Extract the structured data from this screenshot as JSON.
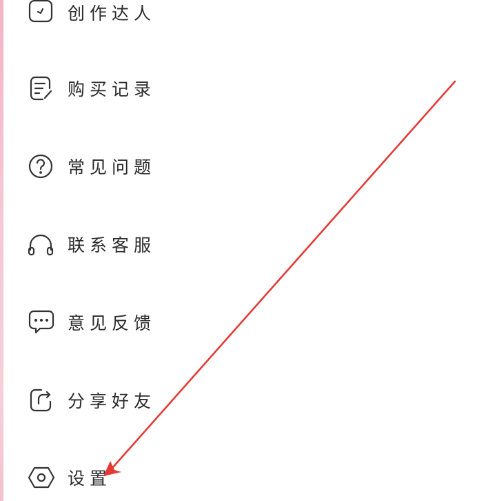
{
  "menu": {
    "items": [
      {
        "label": "创作达人",
        "icon": "creator-icon"
      },
      {
        "label": "购买记录",
        "icon": "purchase-record-icon"
      },
      {
        "label": "常见问题",
        "icon": "question-circle-icon"
      },
      {
        "label": "联系客服",
        "icon": "headset-icon"
      },
      {
        "label": "意见反馈",
        "icon": "chat-feedback-icon"
      },
      {
        "label": "分享好友",
        "icon": "share-icon"
      },
      {
        "label": "设置",
        "icon": "settings-hexagon-icon"
      }
    ]
  },
  "annotation": {
    "arrow_color": "#e53935"
  },
  "colors": {
    "text": "#2b2b2b",
    "icon_stroke": "#333333",
    "accent_strip": "#f6c6d5"
  }
}
